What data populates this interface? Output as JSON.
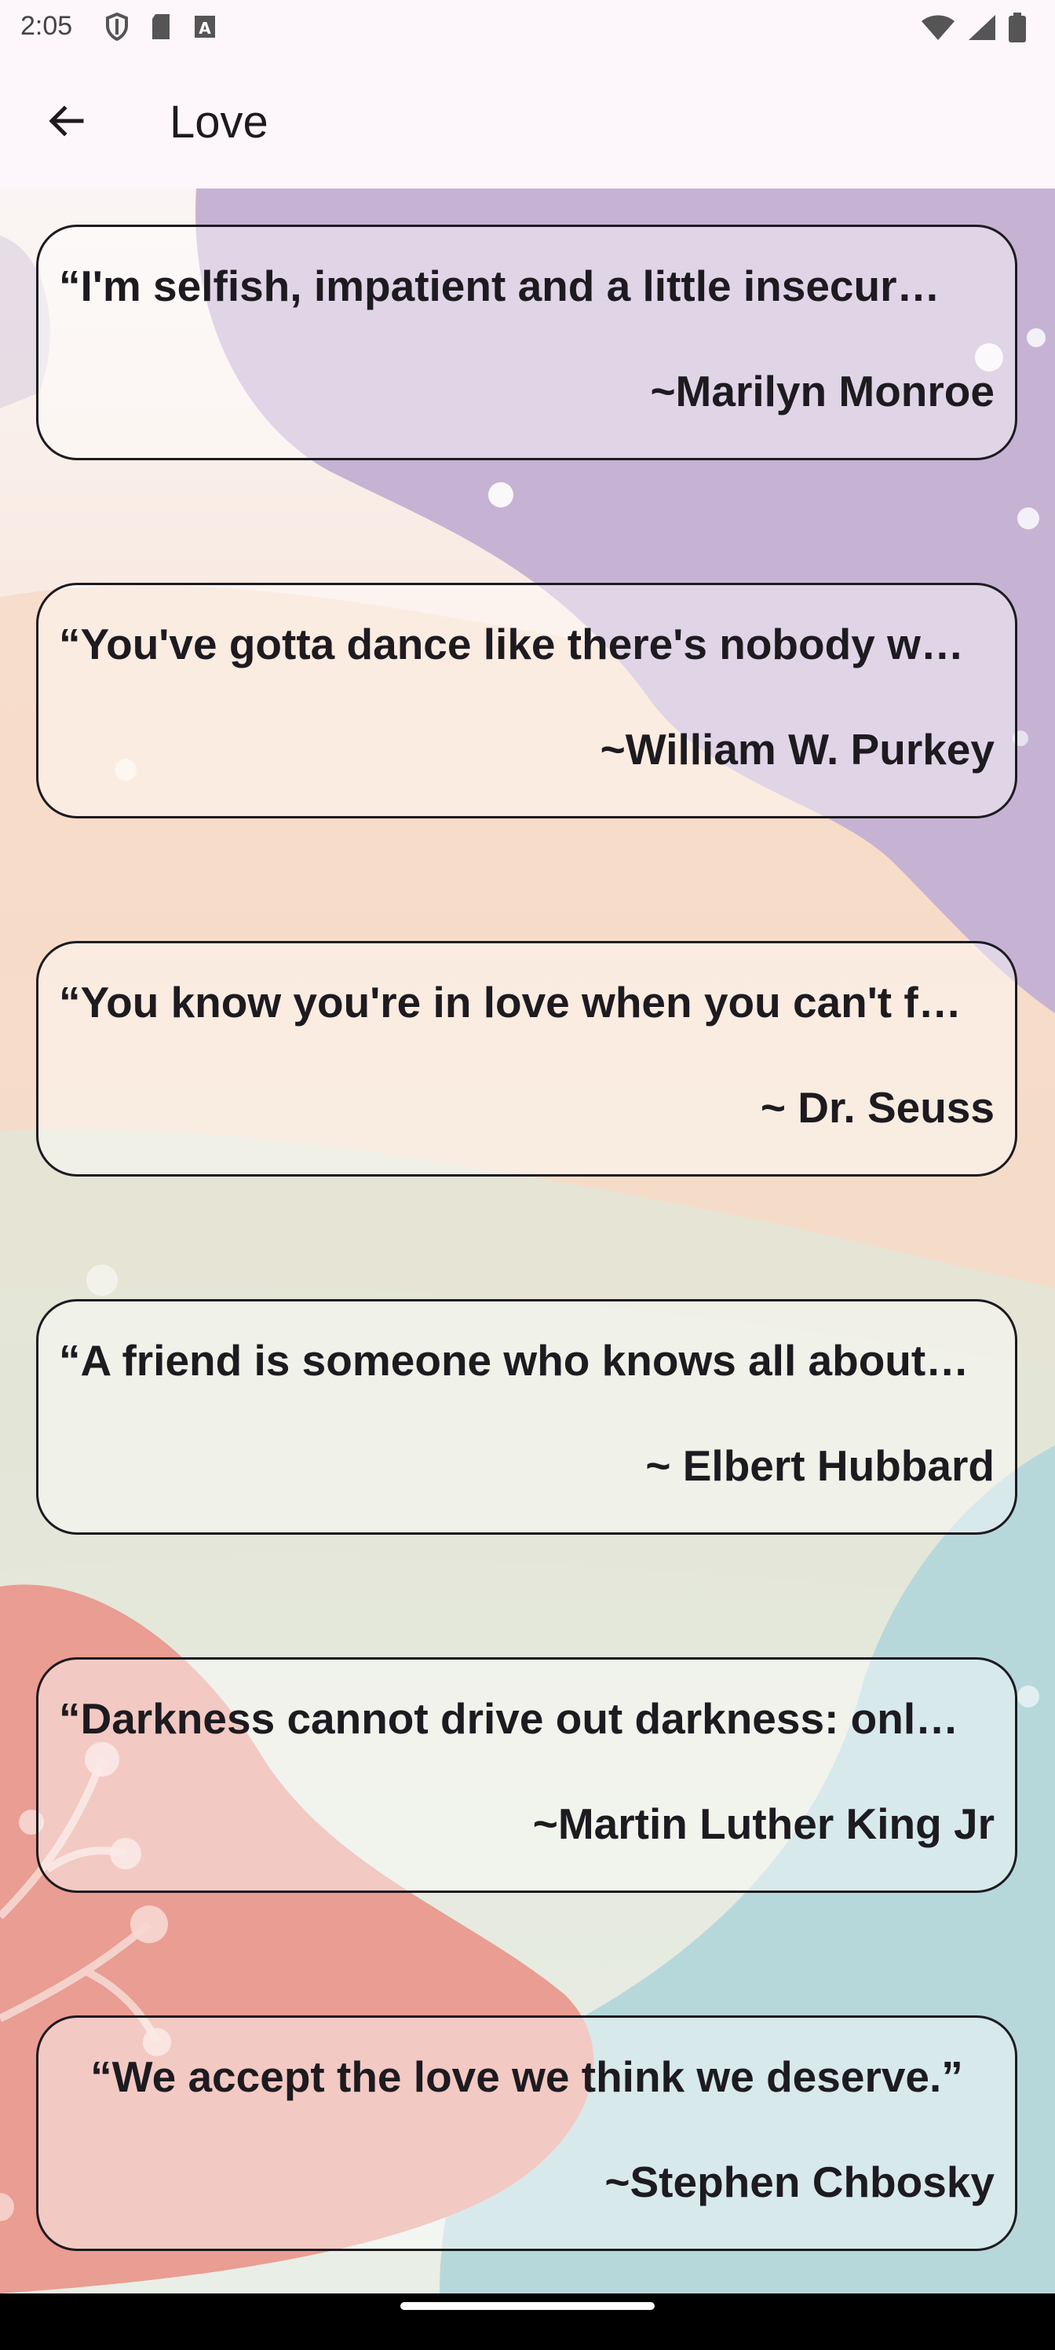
{
  "status_bar": {
    "time": "2:05",
    "left_icons": [
      "shield-icon",
      "sd-card-icon",
      "text-a-icon"
    ],
    "right_icons": [
      "wifi-icon",
      "cellular-signal-icon",
      "battery-icon"
    ]
  },
  "app_bar": {
    "back_icon": "arrow-back-icon",
    "title": "Love"
  },
  "quotes": [
    {
      "text": "“I'm selfish, impatient and a little insecur…",
      "author": "~Marilyn Monroe"
    },
    {
      "text": "“You've gotta dance like there's nobody w…",
      "author": "~William W. Purkey"
    },
    {
      "text": "“You know you're in love when you can't f…",
      "author": "~ Dr. Seuss"
    },
    {
      "text": "“A friend is someone who knows all about…",
      "author": "~ Elbert Hubbard"
    },
    {
      "text": "“Darkness cannot drive out darkness: onl…",
      "author": "~Martin Luther King Jr"
    },
    {
      "text": "“We accept the love we think we deserve.”",
      "author": "~Stephen Chbosky"
    }
  ],
  "colors": {
    "app_bar_bg": "#fdf7fb",
    "card_border": "#1d1b20",
    "text": "#1d1b20",
    "bg_purple": "#c6b3d4",
    "bg_peach": "#f4dcc8",
    "bg_sage": "#dfe6d6",
    "bg_coral": "#ea9d92",
    "bg_teal": "#b7d8db"
  }
}
